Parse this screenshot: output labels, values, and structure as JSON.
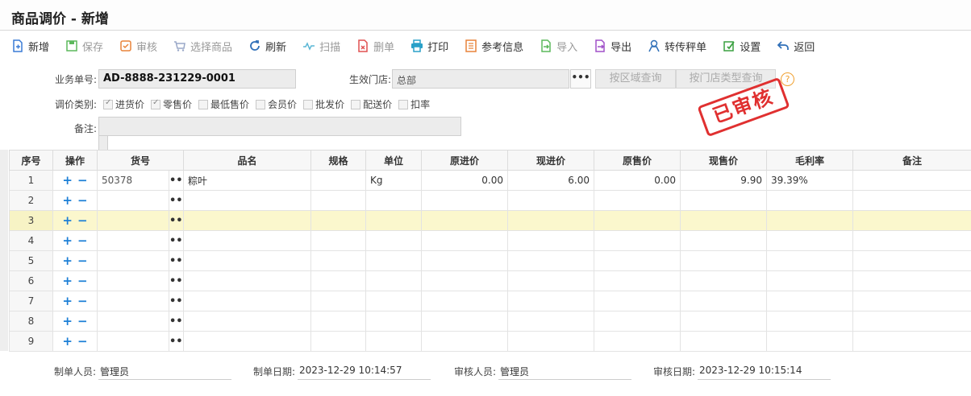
{
  "title": "商品调价 - 新增",
  "toolbar": [
    {
      "label": "新增",
      "icon": "new-doc-icon",
      "color": "#3a7bd5",
      "disabled": false
    },
    {
      "label": "保存",
      "icon": "save-icon",
      "color": "#5cb85c",
      "disabled": true
    },
    {
      "label": "审核",
      "icon": "audit-icon",
      "color": "#e8833a",
      "disabled": true
    },
    {
      "label": "选择商品",
      "icon": "cart-icon",
      "color": "#9aa8c8",
      "disabled": true
    },
    {
      "label": "刷新",
      "icon": "refresh-icon",
      "color": "#2f6fb8",
      "disabled": false
    },
    {
      "label": "扫描",
      "icon": "scan-icon",
      "color": "#5bb7d5",
      "disabled": true
    },
    {
      "label": "删单",
      "icon": "delete-doc-icon",
      "color": "#e05050",
      "disabled": true
    },
    {
      "label": "打印",
      "icon": "print-icon",
      "color": "#2aa0c8",
      "disabled": false
    },
    {
      "label": "参考信息",
      "icon": "reference-icon",
      "color": "#e8833a",
      "disabled": false
    },
    {
      "label": "导入",
      "icon": "import-icon",
      "color": "#5cb85c",
      "disabled": true
    },
    {
      "label": "导出",
      "icon": "export-icon",
      "color": "#a050c8",
      "disabled": false
    },
    {
      "label": "转传秤单",
      "icon": "scale-transfer-icon",
      "color": "#2f6fb8",
      "disabled": false
    },
    {
      "label": "设置",
      "icon": "settings-icon",
      "color": "#3aa040",
      "disabled": false
    },
    {
      "label": "返回",
      "icon": "back-icon",
      "color": "#2f6fb8",
      "disabled": false
    }
  ],
  "form": {
    "doc_no_label": "业务单号:",
    "doc_no": "AD-8888-231229-0001",
    "store_label": "生效门店:",
    "store": "总部",
    "btn_region": "按区域查询",
    "btn_store_type": "按门店类型查询",
    "help": "?",
    "type_label": "调价类别:",
    "types": [
      {
        "label": "进货价",
        "checked": true
      },
      {
        "label": "零售价",
        "checked": true
      },
      {
        "label": "最低售价",
        "checked": false
      },
      {
        "label": "会员价",
        "checked": false
      },
      {
        "label": "批发价",
        "checked": false
      },
      {
        "label": "配送价",
        "checked": false
      },
      {
        "label": "扣率",
        "checked": false
      }
    ],
    "remark_label": "备注:",
    "remark": ""
  },
  "stamp": "已审核",
  "table": {
    "headers": [
      "序号",
      "操作",
      "货号",
      "品名",
      "规格",
      "单位",
      "原进价",
      "现进价",
      "原售价",
      "现售价",
      "毛利率",
      "备注"
    ],
    "rows": [
      [
        "1",
        "50378",
        "粽叶",
        "",
        "Kg",
        "0.00",
        "6.00",
        "0.00",
        "9.90",
        "39.39%",
        ""
      ],
      [
        "2",
        "",
        "",
        "",
        "",
        "",
        "",
        "",
        "",
        "",
        ""
      ],
      [
        "3",
        "",
        "",
        "",
        "",
        "",
        "",
        "",
        "",
        "",
        ""
      ],
      [
        "4",
        "",
        "",
        "",
        "",
        "",
        "",
        "",
        "",
        "",
        ""
      ],
      [
        "5",
        "",
        "",
        "",
        "",
        "",
        "",
        "",
        "",
        "",
        ""
      ],
      [
        "6",
        "",
        "",
        "",
        "",
        "",
        "",
        "",
        "",
        "",
        ""
      ],
      [
        "7",
        "",
        "",
        "",
        "",
        "",
        "",
        "",
        "",
        "",
        ""
      ],
      [
        "8",
        "",
        "",
        "",
        "",
        "",
        "",
        "",
        "",
        "",
        ""
      ],
      [
        "9",
        "",
        "",
        "",
        "",
        "",
        "",
        "",
        "",
        "",
        ""
      ]
    ],
    "highlight_row": 3
  },
  "footer": {
    "maker_label": "制单人员:",
    "maker": "管理员",
    "make_date_label": "制单日期:",
    "make_date": "2023-12-29 10:14:57",
    "auditor_label": "审核人员:",
    "auditor": "管理员",
    "audit_date_label": "审核日期:",
    "audit_date": "2023-12-29 10:15:14"
  }
}
